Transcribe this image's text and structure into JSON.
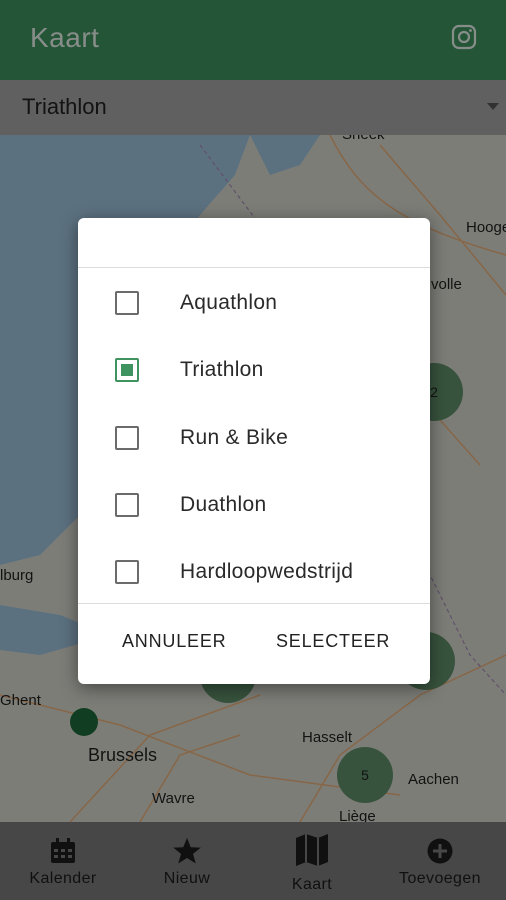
{
  "app": {
    "title": "Kaart"
  },
  "header": {
    "instagram_icon": "instagram-icon"
  },
  "filter": {
    "selected": "Triathlon"
  },
  "map": {
    "cities": [
      "Sneek",
      "Hooge",
      "volle",
      "lburg",
      "Ghent",
      "Brussels",
      "Wavre",
      "Hasselt",
      "Aachen",
      "Liège"
    ],
    "clusters": [
      "2",
      "5"
    ]
  },
  "dialog": {
    "options": [
      {
        "label": "Aquathlon",
        "checked": false
      },
      {
        "label": "Triathlon",
        "checked": true
      },
      {
        "label": "Run & Bike",
        "checked": false
      },
      {
        "label": "Duathlon",
        "checked": false
      },
      {
        "label": "Hardloopwedstrijd",
        "checked": false
      }
    ],
    "cancel_label": "ANNULEER",
    "confirm_label": "SELECTEER"
  },
  "bottomnav": {
    "items": [
      {
        "label": "Kalender",
        "icon": "calendar-icon"
      },
      {
        "label": "Nieuw",
        "icon": "star-icon"
      },
      {
        "label": "Kaart",
        "icon": "map-icon"
      },
      {
        "label": "Toevoegen",
        "icon": "add-circle-icon"
      }
    ]
  },
  "colors": {
    "primary": "#3e935e",
    "cluster": "#5f8f6a"
  }
}
